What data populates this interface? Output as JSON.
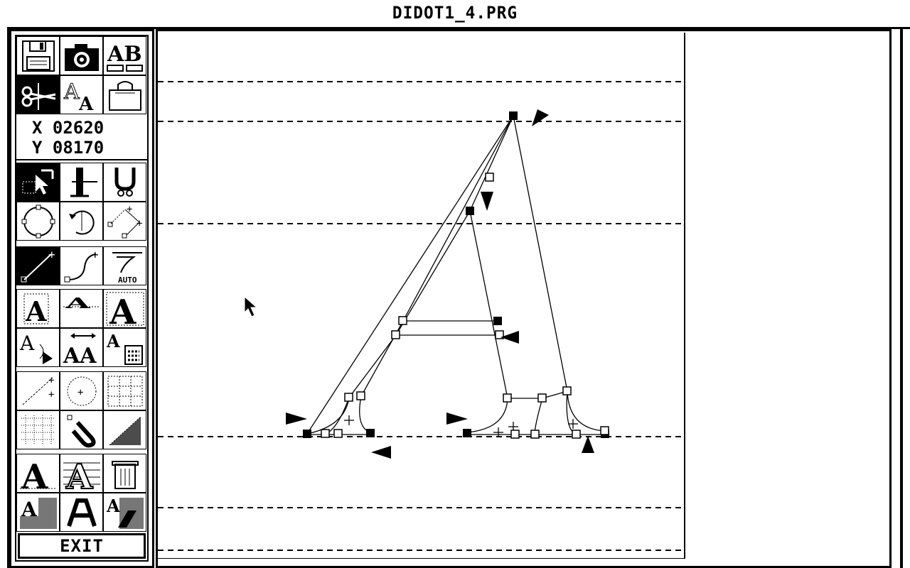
{
  "window": {
    "title": "DIDOT1_4.PRG"
  },
  "toolbox": {
    "coords": {
      "x_label": "X",
      "x_value": "02620",
      "y_label": "Y",
      "y_value": "08170"
    },
    "tools_top": [
      {
        "name": "save-disk-icon"
      },
      {
        "name": "camera-icon"
      },
      {
        "name": "ab-font-icon"
      },
      {
        "name": "scissors-icon"
      },
      {
        "name": "outline-letter-icon"
      },
      {
        "name": "bag-icon"
      }
    ],
    "exit_label": "EXIT",
    "auto_label": "AUTO"
  },
  "canvas": {
    "cursor": "arrow-pointer"
  }
}
